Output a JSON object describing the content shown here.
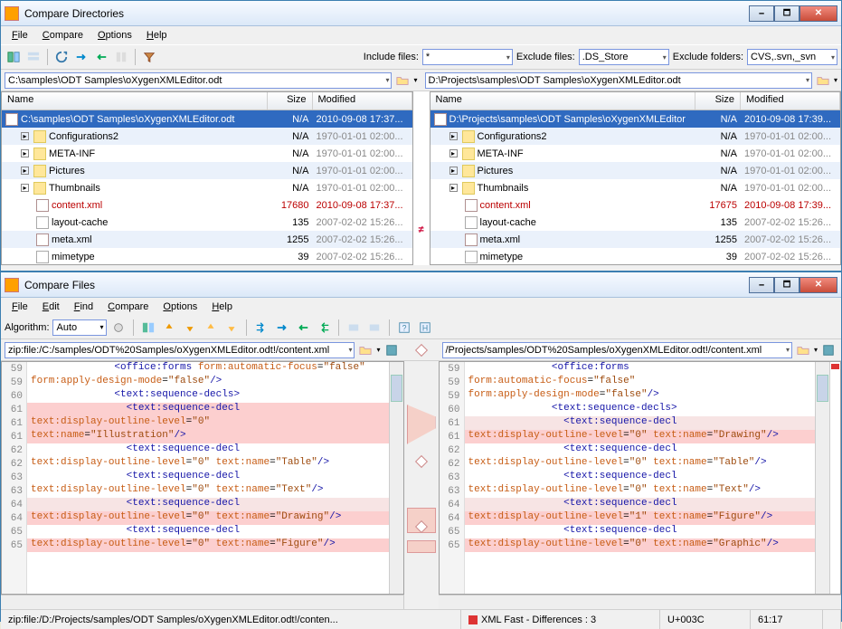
{
  "win1": {
    "title": "Compare Directories",
    "menu": [
      "File",
      "Compare",
      "Options",
      "Help"
    ],
    "filters": {
      "include_label": "Include files:",
      "include_value": "*",
      "exclude_label": "Exclude files:",
      "exclude_value": ".DS_Store",
      "excludef_label": "Exclude folders:",
      "excludef_value": "CVS,.svn,_svn"
    },
    "left_path": "C:\\samples\\ODT Samples\\oXygenXMLEditor.odt",
    "right_path": "D:\\Projects\\samples\\ODT Samples\\oXygenXMLEditor.odt",
    "columns": {
      "name": "Name",
      "size": "Size",
      "mod": "Modified"
    },
    "left_rows": [
      {
        "icon": "xml",
        "name": "C:\\samples\\ODT Samples\\oXygenXMLEditor.odt",
        "size": "N/A",
        "mod": "2010-09-08  17:37...",
        "cls": "sel",
        "exp": ""
      },
      {
        "icon": "folder",
        "name": "Configurations2",
        "size": "N/A",
        "mod": "1970-01-01  02:00...",
        "cls": "eq",
        "exp": "▹",
        "ind": 1
      },
      {
        "icon": "folder",
        "name": "META-INF",
        "size": "N/A",
        "mod": "1970-01-01  02:00...",
        "cls": "",
        "exp": "▹",
        "ind": 1
      },
      {
        "icon": "folder",
        "name": "Pictures",
        "size": "N/A",
        "mod": "1970-01-01  02:00...",
        "cls": "eq",
        "exp": "▹",
        "ind": 1
      },
      {
        "icon": "folder",
        "name": "Thumbnails",
        "size": "N/A",
        "mod": "1970-01-01  02:00...",
        "cls": "",
        "exp": "▹",
        "ind": 1
      },
      {
        "icon": "xml",
        "name": "content.xml",
        "size": "17680",
        "mod": "2010-09-08  17:37...",
        "cls": "diff",
        "ind": 2
      },
      {
        "icon": "file",
        "name": "layout-cache",
        "size": "135",
        "mod": "2007-02-02  15:26...",
        "cls": "",
        "ind": 2
      },
      {
        "icon": "xml",
        "name": "meta.xml",
        "size": "1255",
        "mod": "2007-02-02  15:26...",
        "cls": "eq",
        "ind": 2
      },
      {
        "icon": "file",
        "name": "mimetype",
        "size": "39",
        "mod": "2007-02-02  15:26...",
        "cls": "",
        "ind": 2
      }
    ],
    "right_rows": [
      {
        "icon": "xml",
        "name": "D:\\Projects\\samples\\ODT Samples\\oXygenXMLEditor",
        "size": "N/A",
        "mod": "2010-09-08  17:39...",
        "cls": "sel",
        "exp": ""
      },
      {
        "icon": "folder",
        "name": "Configurations2",
        "size": "N/A",
        "mod": "1970-01-01  02:00...",
        "cls": "eq",
        "exp": "▹",
        "ind": 1
      },
      {
        "icon": "folder",
        "name": "META-INF",
        "size": "N/A",
        "mod": "1970-01-01  02:00...",
        "cls": "",
        "exp": "▹",
        "ind": 1
      },
      {
        "icon": "folder",
        "name": "Pictures",
        "size": "N/A",
        "mod": "1970-01-01  02:00...",
        "cls": "eq",
        "exp": "▹",
        "ind": 1
      },
      {
        "icon": "folder",
        "name": "Thumbnails",
        "size": "N/A",
        "mod": "1970-01-01  02:00...",
        "cls": "",
        "exp": "▹",
        "ind": 1
      },
      {
        "icon": "xml",
        "name": "content.xml",
        "size": "17675",
        "mod": "2010-09-08  17:39...",
        "cls": "diff",
        "ind": 2
      },
      {
        "icon": "file",
        "name": "layout-cache",
        "size": "135",
        "mod": "2007-02-02  15:26...",
        "cls": "",
        "ind": 2
      },
      {
        "icon": "xml",
        "name": "meta.xml",
        "size": "1255",
        "mod": "2007-02-02  15:26...",
        "cls": "eq",
        "ind": 2
      },
      {
        "icon": "file",
        "name": "mimetype",
        "size": "39",
        "mod": "2007-02-02  15:26...",
        "cls": "",
        "ind": 2
      }
    ]
  },
  "win2": {
    "title": "Compare Files",
    "menu": [
      "File",
      "Edit",
      "Find",
      "Compare",
      "Options",
      "Help"
    ],
    "algo_label": "Algorithm:",
    "algo_value": "Auto",
    "left_path": "zip:file:/C:/samples/ODT%20Samples/oXygenXMLEditor.odt!/content.xml",
    "right_path": "/Projects/samples/ODT%20Samples/oXygenXMLEditor.odt!/content.xml",
    "left_code": [
      {
        "n": "59",
        "hl": "",
        "frag": [
          {
            "t": "              ",
            "c": ""
          },
          {
            "t": "<office:forms ",
            "c": "tag"
          },
          {
            "t": "form:automatic-focus",
            "c": "attr"
          },
          {
            "t": "=",
            "c": ""
          },
          {
            "t": "\"false\"",
            "c": "val"
          }
        ]
      },
      {
        "n": "59",
        "hl": "",
        "frag": [
          {
            "t": "form:apply-design-mode",
            "c": "attr"
          },
          {
            "t": "=",
            "c": ""
          },
          {
            "t": "\"false\"",
            "c": "val"
          },
          {
            "t": "/>",
            "c": "tag"
          }
        ]
      },
      {
        "n": "60",
        "hl": "",
        "frag": [
          {
            "t": "              ",
            "c": ""
          },
          {
            "t": "<text:sequence-decls>",
            "c": "tag"
          }
        ]
      },
      {
        "n": "61",
        "hl": "hl",
        "frag": [
          {
            "t": "                ",
            "c": ""
          },
          {
            "t": "<text:sequence-decl",
            "c": "tag"
          }
        ]
      },
      {
        "n": "61",
        "hl": "hl",
        "frag": [
          {
            "t": "text:display-outline-level",
            "c": "attr"
          },
          {
            "t": "=",
            "c": ""
          },
          {
            "t": "\"0\"",
            "c": "val"
          }
        ]
      },
      {
        "n": "61",
        "hl": "hl",
        "frag": [
          {
            "t": "text:name",
            "c": "attr"
          },
          {
            "t": "=",
            "c": ""
          },
          {
            "t": "\"Illustration\"",
            "c": "val"
          },
          {
            "t": "/>",
            "c": "tag"
          }
        ]
      },
      {
        "n": "62",
        "hl": "",
        "frag": [
          {
            "t": "                ",
            "c": ""
          },
          {
            "t": "<text:sequence-decl",
            "c": "tag"
          }
        ]
      },
      {
        "n": "62",
        "hl": "",
        "frag": [
          {
            "t": "text:display-outline-level",
            "c": "attr"
          },
          {
            "t": "=",
            "c": ""
          },
          {
            "t": "\"0\"",
            "c": "val"
          },
          {
            "t": " ",
            "c": ""
          },
          {
            "t": "text:name",
            "c": "attr"
          },
          {
            "t": "=",
            "c": ""
          },
          {
            "t": "\"Table\"",
            "c": "val"
          },
          {
            "t": "/>",
            "c": "tag"
          }
        ]
      },
      {
        "n": "63",
        "hl": "",
        "frag": [
          {
            "t": "                ",
            "c": ""
          },
          {
            "t": "<text:sequence-decl",
            "c": "tag"
          }
        ]
      },
      {
        "n": "63",
        "hl": "",
        "frag": [
          {
            "t": "text:display-outline-level",
            "c": "attr"
          },
          {
            "t": "=",
            "c": ""
          },
          {
            "t": "\"0\"",
            "c": "val"
          },
          {
            "t": " ",
            "c": ""
          },
          {
            "t": "text:name",
            "c": "attr"
          },
          {
            "t": "=",
            "c": ""
          },
          {
            "t": "\"Text\"",
            "c": "val"
          },
          {
            "t": "/>",
            "c": "tag"
          }
        ]
      },
      {
        "n": "64",
        "hl": "hl2",
        "frag": [
          {
            "t": "                ",
            "c": ""
          },
          {
            "t": "<text:sequence-decl",
            "c": "tag"
          }
        ]
      },
      {
        "n": "64",
        "hl": "hl",
        "frag": [
          {
            "t": "text:display-outline-level",
            "c": "attr"
          },
          {
            "t": "=",
            "c": ""
          },
          {
            "t": "\"0\"",
            "c": "val"
          },
          {
            "t": " ",
            "c": ""
          },
          {
            "t": "text:name",
            "c": "attr"
          },
          {
            "t": "=",
            "c": ""
          },
          {
            "t": "\"Drawing\"",
            "c": "val"
          },
          {
            "t": "/>",
            "c": "tag"
          }
        ]
      },
      {
        "n": "65",
        "hl": "",
        "frag": [
          {
            "t": "                ",
            "c": ""
          },
          {
            "t": "<text:sequence-decl",
            "c": "tag"
          }
        ]
      },
      {
        "n": "65",
        "hl": "hl",
        "frag": [
          {
            "t": "text:display-outline-level",
            "c": "attr"
          },
          {
            "t": "=",
            "c": ""
          },
          {
            "t": "\"0\"",
            "c": "val"
          },
          {
            "t": " ",
            "c": ""
          },
          {
            "t": "text:name",
            "c": "attr"
          },
          {
            "t": "=",
            "c": ""
          },
          {
            "t": "\"Figure\"",
            "c": "val"
          },
          {
            "t": "/>",
            "c": "tag"
          }
        ]
      }
    ],
    "right_code": [
      {
        "n": "59",
        "hl": "",
        "frag": [
          {
            "t": "              ",
            "c": ""
          },
          {
            "t": "<office:forms",
            "c": "tag"
          }
        ]
      },
      {
        "n": "59",
        "hl": "",
        "frag": [
          {
            "t": "form:automatic-focus",
            "c": "attr"
          },
          {
            "t": "=",
            "c": ""
          },
          {
            "t": "\"false\"",
            "c": "val"
          }
        ]
      },
      {
        "n": "59",
        "hl": "",
        "frag": [
          {
            "t": "form:apply-design-mode",
            "c": "attr"
          },
          {
            "t": "=",
            "c": ""
          },
          {
            "t": "\"false\"",
            "c": "val"
          },
          {
            "t": "/>",
            "c": "tag"
          }
        ]
      },
      {
        "n": "60",
        "hl": "",
        "frag": [
          {
            "t": "              ",
            "c": ""
          },
          {
            "t": "<text:sequence-decls>",
            "c": "tag"
          }
        ]
      },
      {
        "n": "61",
        "hl": "hl2",
        "frag": [
          {
            "t": "                ",
            "c": ""
          },
          {
            "t": "<text:sequence-decl",
            "c": "tag"
          }
        ]
      },
      {
        "n": "61",
        "hl": "hl",
        "frag": [
          {
            "t": "text:display-outline-level",
            "c": "attr"
          },
          {
            "t": "=",
            "c": ""
          },
          {
            "t": "\"0\"",
            "c": "val"
          },
          {
            "t": " ",
            "c": ""
          },
          {
            "t": "text:name",
            "c": "attr"
          },
          {
            "t": "=",
            "c": ""
          },
          {
            "t": "\"Drawing\"",
            "c": "val"
          },
          {
            "t": "/>",
            "c": "tag"
          }
        ]
      },
      {
        "n": "62",
        "hl": "",
        "frag": [
          {
            "t": "                ",
            "c": ""
          },
          {
            "t": "<text:sequence-decl",
            "c": "tag"
          }
        ]
      },
      {
        "n": "62",
        "hl": "",
        "frag": [
          {
            "t": "text:display-outline-level",
            "c": "attr"
          },
          {
            "t": "=",
            "c": ""
          },
          {
            "t": "\"0\"",
            "c": "val"
          },
          {
            "t": " ",
            "c": ""
          },
          {
            "t": "text:name",
            "c": "attr"
          },
          {
            "t": "=",
            "c": ""
          },
          {
            "t": "\"Table\"",
            "c": "val"
          },
          {
            "t": "/>",
            "c": "tag"
          }
        ]
      },
      {
        "n": "63",
        "hl": "",
        "frag": [
          {
            "t": "                ",
            "c": ""
          },
          {
            "t": "<text:sequence-decl",
            "c": "tag"
          }
        ]
      },
      {
        "n": "63",
        "hl": "",
        "frag": [
          {
            "t": "text:display-outline-level",
            "c": "attr"
          },
          {
            "t": "=",
            "c": ""
          },
          {
            "t": "\"0\"",
            "c": "val"
          },
          {
            "t": " ",
            "c": ""
          },
          {
            "t": "text:name",
            "c": "attr"
          },
          {
            "t": "=",
            "c": ""
          },
          {
            "t": "\"Text\"",
            "c": "val"
          },
          {
            "t": "/>",
            "c": "tag"
          }
        ]
      },
      {
        "n": "64",
        "hl": "hl2",
        "frag": [
          {
            "t": "                ",
            "c": ""
          },
          {
            "t": "<text:sequence-decl",
            "c": "tag"
          }
        ]
      },
      {
        "n": "64",
        "hl": "hl",
        "frag": [
          {
            "t": "text:display-outline-level",
            "c": "attr"
          },
          {
            "t": "=",
            "c": ""
          },
          {
            "t": "\"1\"",
            "c": "val"
          },
          {
            "t": " ",
            "c": ""
          },
          {
            "t": "text:name",
            "c": "attr"
          },
          {
            "t": "=",
            "c": ""
          },
          {
            "t": "\"Figure\"",
            "c": "val"
          },
          {
            "t": "/>",
            "c": "tag"
          }
        ]
      },
      {
        "n": "65",
        "hl": "",
        "frag": [
          {
            "t": "                ",
            "c": ""
          },
          {
            "t": "<text:sequence-decl",
            "c": "tag"
          }
        ]
      },
      {
        "n": "65",
        "hl": "hl",
        "frag": [
          {
            "t": "text:display-outline-level",
            "c": "attr"
          },
          {
            "t": "=",
            "c": ""
          },
          {
            "t": "\"0\"",
            "c": "val"
          },
          {
            "t": " ",
            "c": ""
          },
          {
            "t": "text:name",
            "c": "attr"
          },
          {
            "t": "=",
            "c": ""
          },
          {
            "t": "\"Graphic\"",
            "c": "val"
          },
          {
            "t": "/>",
            "c": "tag"
          }
        ]
      }
    ],
    "status": {
      "path": "zip:file:/D:/Projects/samples/ODT Samples/oXygenXMLEditor.odt!/conten...",
      "mode": "XML Fast - Differences : 3",
      "codepoint": "U+003C",
      "pos": "61:17"
    }
  }
}
